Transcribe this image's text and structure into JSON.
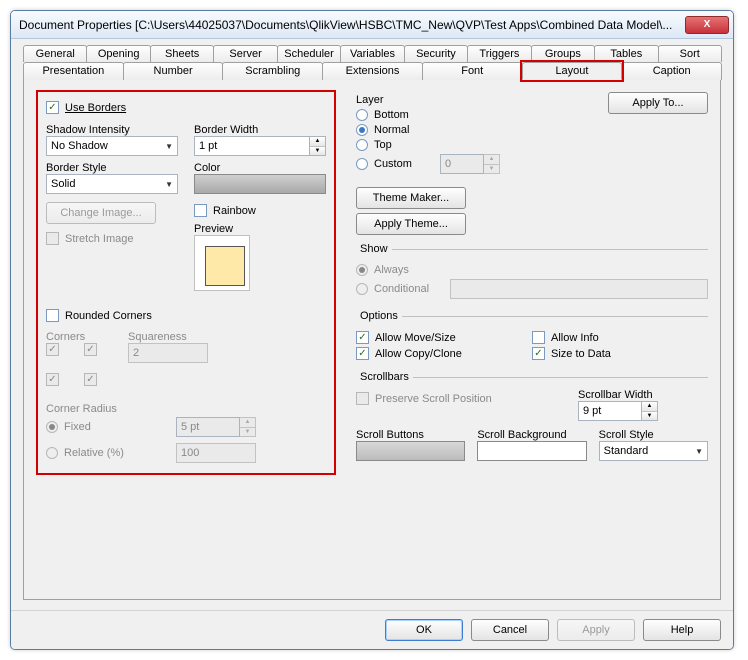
{
  "window": {
    "title": "Document Properties [C:\\Users\\44025037\\Documents\\QlikView\\HSBC\\TMC_New\\QVP\\Test Apps\\Combined Data Model\\..."
  },
  "tabs_row1": [
    "General",
    "Opening",
    "Sheets",
    "Server",
    "Scheduler",
    "Variables",
    "Security",
    "Triggers",
    "Groups",
    "Tables",
    "Sort"
  ],
  "tabs_row2": [
    "Presentation",
    "Number",
    "Scrambling",
    "Extensions",
    "Font",
    "Layout",
    "Caption"
  ],
  "active_tab": "Layout",
  "borders": {
    "use_borders_label": "Use Borders",
    "use_borders_checked": true,
    "shadow_intensity_label": "Shadow Intensity",
    "shadow_intensity_value": "No Shadow",
    "border_width_label": "Border Width",
    "border_width_value": "1 pt",
    "border_style_label": "Border Style",
    "border_style_value": "Solid",
    "color_label": "Color",
    "change_image_label": "Change Image...",
    "rainbow_label": "Rainbow",
    "stretch_image_label": "Stretch Image",
    "preview_label": "Preview"
  },
  "rounded": {
    "rounded_corners_label": "Rounded Corners",
    "corners_label": "Corners",
    "squareness_label": "Squareness",
    "squareness_value": "2",
    "corner_radius_label": "Corner Radius",
    "fixed_label": "Fixed",
    "fixed_value_selected": true,
    "fixed_value": "5 pt",
    "relative_label": "Relative (%)",
    "relative_value": "100"
  },
  "layer": {
    "group_label": "Layer",
    "bottom": "Bottom",
    "normal": "Normal",
    "top": "Top",
    "custom": "Custom",
    "custom_value": "0",
    "selected": "Normal"
  },
  "apply_to_label": "Apply To...",
  "theme_maker_label": "Theme Maker...",
  "apply_theme_label": "Apply Theme...",
  "show": {
    "group_label": "Show",
    "always": "Always",
    "conditional": "Conditional"
  },
  "options": {
    "group_label": "Options",
    "allow_move": "Allow Move/Size",
    "allow_info": "Allow Info",
    "allow_copy": "Allow Copy/Clone",
    "size_to_data": "Size to Data",
    "allow_move_checked": true,
    "allow_info_checked": false,
    "allow_copy_checked": true,
    "size_to_data_checked": true
  },
  "scrollbars": {
    "group_label": "Scrollbars",
    "preserve_label": "Preserve Scroll Position",
    "scrollbar_width_label": "Scrollbar Width",
    "scrollbar_width_value": "9 pt",
    "scroll_buttons_label": "Scroll Buttons",
    "scroll_background_label": "Scroll Background",
    "scroll_style_label": "Scroll Style",
    "scroll_style_value": "Standard"
  },
  "buttons": {
    "ok": "OK",
    "cancel": "Cancel",
    "apply": "Apply",
    "help": "Help"
  }
}
